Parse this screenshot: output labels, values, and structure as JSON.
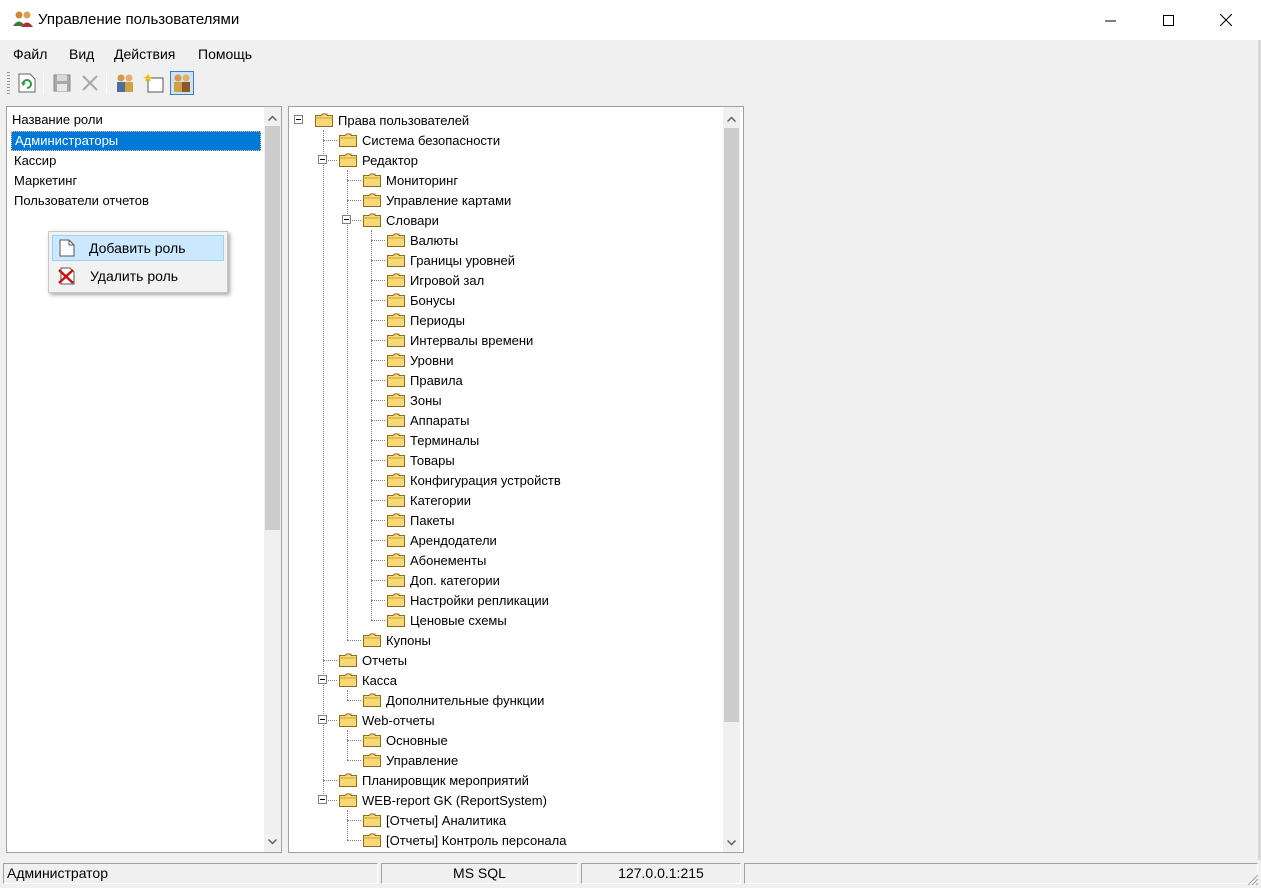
{
  "window": {
    "title": "Управление пользователями"
  },
  "menu": [
    "Файл",
    "Вид",
    "Действия",
    "Помощь"
  ],
  "roles": {
    "header": "Название роли",
    "items": [
      "Администраторы",
      "Кассир",
      "Маркетинг",
      "Пользователи отчетов"
    ],
    "selected_index": 0
  },
  "context_menu": {
    "items": [
      {
        "label": "Добавить роль",
        "icon": "new-document-icon"
      },
      {
        "label": "Удалить роль",
        "icon": "delete-red-x-icon"
      }
    ]
  },
  "tree": {
    "nodes": [
      {
        "label": "Права пользователей",
        "level": 0,
        "expanded": true
      },
      {
        "label": "Система безопасности",
        "level": 1
      },
      {
        "label": "Редактор",
        "level": 1,
        "expanded": true
      },
      {
        "label": "Мониторинг",
        "level": 2
      },
      {
        "label": "Управление картами",
        "level": 2
      },
      {
        "label": "Словари",
        "level": 2,
        "expanded": true
      },
      {
        "label": "Валюты",
        "level": 3
      },
      {
        "label": "Границы уровней",
        "level": 3
      },
      {
        "label": "Игровой зал",
        "level": 3
      },
      {
        "label": "Бонусы",
        "level": 3
      },
      {
        "label": "Периоды",
        "level": 3
      },
      {
        "label": "Интервалы времени",
        "level": 3
      },
      {
        "label": "Уровни",
        "level": 3
      },
      {
        "label": "Правила",
        "level": 3
      },
      {
        "label": "Зоны",
        "level": 3
      },
      {
        "label": "Аппараты",
        "level": 3
      },
      {
        "label": "Терминалы",
        "level": 3
      },
      {
        "label": "Товары",
        "level": 3
      },
      {
        "label": "Конфигурация устройств",
        "level": 3
      },
      {
        "label": "Категории",
        "level": 3
      },
      {
        "label": "Пакеты",
        "level": 3
      },
      {
        "label": "Арендодатели",
        "level": 3
      },
      {
        "label": "Абонементы",
        "level": 3
      },
      {
        "label": "Доп. категории",
        "level": 3
      },
      {
        "label": "Настройки репликации",
        "level": 3
      },
      {
        "label": "Ценовые схемы",
        "level": 3
      },
      {
        "label": "Купоны",
        "level": 2
      },
      {
        "label": "Отчеты",
        "level": 1
      },
      {
        "label": "Касса",
        "level": 1,
        "expanded": true
      },
      {
        "label": "Дополнительные функции",
        "level": 2
      },
      {
        "label": "Web-отчеты",
        "level": 1,
        "expanded": true
      },
      {
        "label": "Основные",
        "level": 2
      },
      {
        "label": "Управление",
        "level": 2
      },
      {
        "label": "Планировщик мероприятий",
        "level": 1
      },
      {
        "label": "WEB-report GK (ReportSystem)",
        "level": 1,
        "expanded": true
      },
      {
        "label": "[Отчеты] Аналитика",
        "level": 2
      },
      {
        "label": "[Отчеты] Контроль персонала",
        "level": 2
      }
    ]
  },
  "status": {
    "user": "Администратор",
    "db": "MS SQL",
    "server": "127.0.0.1:215"
  },
  "colors": {
    "selection": "#0078d7",
    "menu_hover": "#cce8ff",
    "folder": "#f8d775"
  }
}
